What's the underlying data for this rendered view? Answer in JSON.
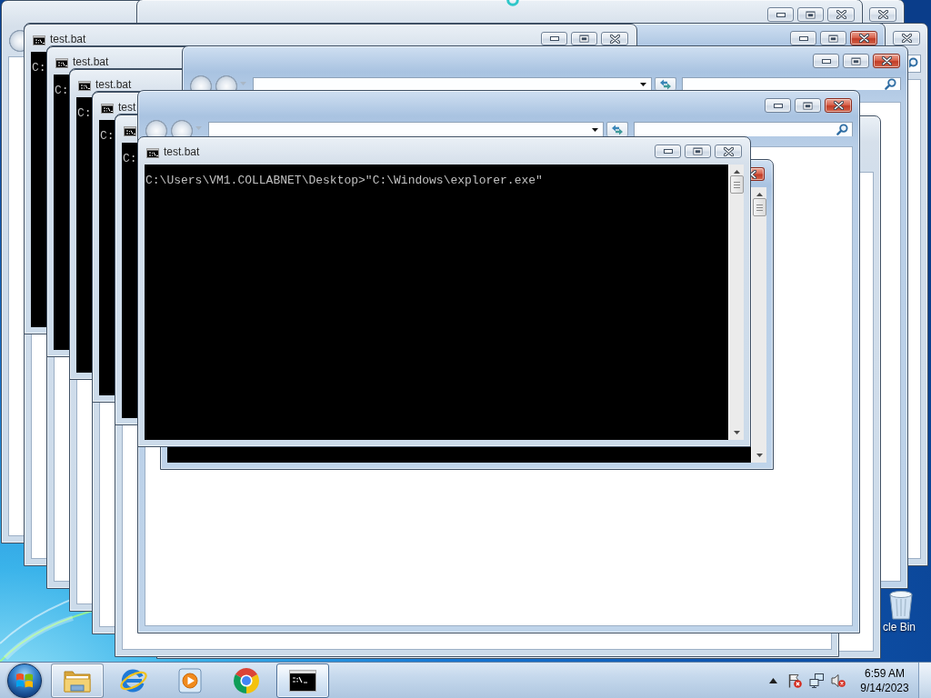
{
  "windows": [
    {
      "kind": "explorer"
    },
    {
      "kind": "explorer",
      "active": false
    },
    {
      "kind": "explorer",
      "active": false
    },
    {
      "kind": "explorer"
    },
    {
      "kind": "explorer",
      "active": false
    },
    {
      "kind": "explorer",
      "active": true
    },
    {
      "kind": "console",
      "active": false,
      "title": "test.bat",
      "lines": [
        "C:"
      ]
    },
    {
      "kind": "explorer"
    },
    {
      "kind": "console",
      "title": "test.bat",
      "lines": [
        "C:"
      ]
    },
    {
      "kind": "explorer"
    },
    {
      "kind": "console",
      "title": "test.bat",
      "lines": [
        "C:"
      ]
    },
    {
      "kind": "explorer",
      "active": true
    },
    {
      "kind": "explorer"
    },
    {
      "kind": "explorer"
    },
    {
      "kind": "console",
      "title": "test",
      "lines": [
        "C:"
      ]
    },
    {
      "kind": "explorer"
    },
    {
      "kind": "console",
      "lines": [
        "C:"
      ]
    },
    {
      "kind": "explorer",
      "active": true
    },
    {
      "kind": "console",
      "active": true
    },
    {
      "kind": "console",
      "active": false,
      "title": "test.bat",
      "lines": [
        "C:\\Users\\VM1.COLLABNET\\Desktop>\"C:\\Windows\\explorer.exe\""
      ]
    }
  ],
  "desktop_icons": [
    {
      "label": "cle Bin"
    }
  ],
  "taskbar": {
    "apps": [
      {
        "kind": "folder",
        "running": true,
        "selected": false
      },
      {
        "kind": "browser",
        "running": false,
        "selected": false
      },
      {
        "kind": "player",
        "running": false,
        "selected": false
      },
      {
        "kind": "roundel",
        "running": false,
        "selected": false
      },
      {
        "kind": "console",
        "running": true,
        "selected": true
      }
    ],
    "tray": {
      "alert": true,
      "muted": true
    },
    "clock": {
      "time": "6:59 AM",
      "date": "9/14/2023"
    }
  }
}
